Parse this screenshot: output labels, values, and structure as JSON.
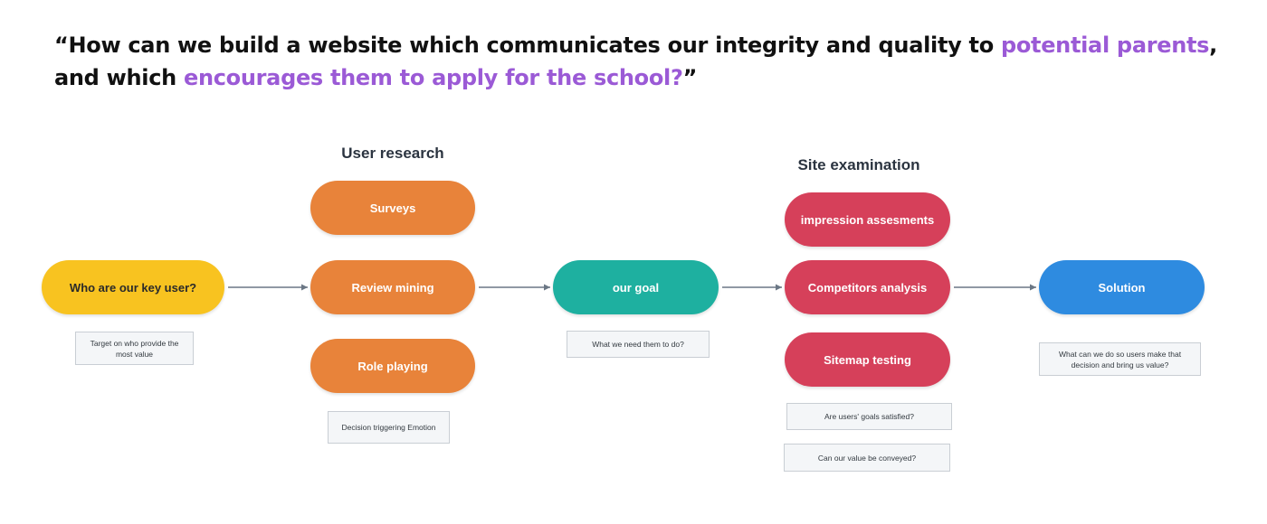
{
  "headline": {
    "part1": "“How can we build a website which communicates our integrity and quality to ",
    "highlight1": "potential parents",
    "part2": ", and which ",
    "highlight2": "encourages them to apply for the school?",
    "part3": "”"
  },
  "sections": {
    "user_research": "User research",
    "site_examination": "Site examination"
  },
  "nodes": {
    "key_user": "Who are our key user?",
    "surveys": "Surveys",
    "review_mining": "Review mining",
    "role_playing": "Role playing",
    "our_goal": "our goal",
    "impression": "impression assesments",
    "competitors": "Competitors analysis",
    "sitemap": "Sitemap testing",
    "solution": "Solution"
  },
  "notes": {
    "key_user": "Target on who provide the most value",
    "role_playing": "Decision triggering Emotion",
    "our_goal": "What we need them to do?",
    "goals_satisfied": "Are users' goals satisfied?",
    "value_conveyed": "Can our value be conveyed?",
    "solution": "What can we do so users make that decision and bring us value?"
  },
  "colors": {
    "yellow": "#f8c320",
    "orange": "#e8833a",
    "teal": "#1eb0a0",
    "crimson": "#d6405a",
    "blue": "#2e8be0",
    "highlight": "#9b5ad6",
    "arrow": "#6b7785"
  }
}
